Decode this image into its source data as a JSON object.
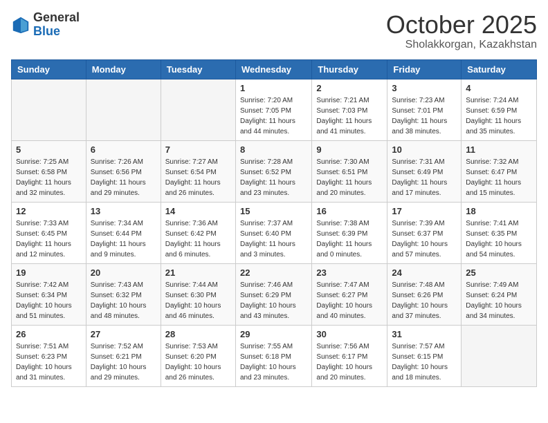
{
  "logo": {
    "general": "General",
    "blue": "Blue"
  },
  "title": "October 2025",
  "location": "Sholakkorgan, Kazakhstan",
  "weekdays": [
    "Sunday",
    "Monday",
    "Tuesday",
    "Wednesday",
    "Thursday",
    "Friday",
    "Saturday"
  ],
  "weeks": [
    [
      {
        "day": "",
        "info": ""
      },
      {
        "day": "",
        "info": ""
      },
      {
        "day": "",
        "info": ""
      },
      {
        "day": "1",
        "info": "Sunrise: 7:20 AM\nSunset: 7:05 PM\nDaylight: 11 hours\nand 44 minutes."
      },
      {
        "day": "2",
        "info": "Sunrise: 7:21 AM\nSunset: 7:03 PM\nDaylight: 11 hours\nand 41 minutes."
      },
      {
        "day": "3",
        "info": "Sunrise: 7:23 AM\nSunset: 7:01 PM\nDaylight: 11 hours\nand 38 minutes."
      },
      {
        "day": "4",
        "info": "Sunrise: 7:24 AM\nSunset: 6:59 PM\nDaylight: 11 hours\nand 35 minutes."
      }
    ],
    [
      {
        "day": "5",
        "info": "Sunrise: 7:25 AM\nSunset: 6:58 PM\nDaylight: 11 hours\nand 32 minutes."
      },
      {
        "day": "6",
        "info": "Sunrise: 7:26 AM\nSunset: 6:56 PM\nDaylight: 11 hours\nand 29 minutes."
      },
      {
        "day": "7",
        "info": "Sunrise: 7:27 AM\nSunset: 6:54 PM\nDaylight: 11 hours\nand 26 minutes."
      },
      {
        "day": "8",
        "info": "Sunrise: 7:28 AM\nSunset: 6:52 PM\nDaylight: 11 hours\nand 23 minutes."
      },
      {
        "day": "9",
        "info": "Sunrise: 7:30 AM\nSunset: 6:51 PM\nDaylight: 11 hours\nand 20 minutes."
      },
      {
        "day": "10",
        "info": "Sunrise: 7:31 AM\nSunset: 6:49 PM\nDaylight: 11 hours\nand 17 minutes."
      },
      {
        "day": "11",
        "info": "Sunrise: 7:32 AM\nSunset: 6:47 PM\nDaylight: 11 hours\nand 15 minutes."
      }
    ],
    [
      {
        "day": "12",
        "info": "Sunrise: 7:33 AM\nSunset: 6:45 PM\nDaylight: 11 hours\nand 12 minutes."
      },
      {
        "day": "13",
        "info": "Sunrise: 7:34 AM\nSunset: 6:44 PM\nDaylight: 11 hours\nand 9 minutes."
      },
      {
        "day": "14",
        "info": "Sunrise: 7:36 AM\nSunset: 6:42 PM\nDaylight: 11 hours\nand 6 minutes."
      },
      {
        "day": "15",
        "info": "Sunrise: 7:37 AM\nSunset: 6:40 PM\nDaylight: 11 hours\nand 3 minutes."
      },
      {
        "day": "16",
        "info": "Sunrise: 7:38 AM\nSunset: 6:39 PM\nDaylight: 11 hours\nand 0 minutes."
      },
      {
        "day": "17",
        "info": "Sunrise: 7:39 AM\nSunset: 6:37 PM\nDaylight: 10 hours\nand 57 minutes."
      },
      {
        "day": "18",
        "info": "Sunrise: 7:41 AM\nSunset: 6:35 PM\nDaylight: 10 hours\nand 54 minutes."
      }
    ],
    [
      {
        "day": "19",
        "info": "Sunrise: 7:42 AM\nSunset: 6:34 PM\nDaylight: 10 hours\nand 51 minutes."
      },
      {
        "day": "20",
        "info": "Sunrise: 7:43 AM\nSunset: 6:32 PM\nDaylight: 10 hours\nand 48 minutes."
      },
      {
        "day": "21",
        "info": "Sunrise: 7:44 AM\nSunset: 6:30 PM\nDaylight: 10 hours\nand 46 minutes."
      },
      {
        "day": "22",
        "info": "Sunrise: 7:46 AM\nSunset: 6:29 PM\nDaylight: 10 hours\nand 43 minutes."
      },
      {
        "day": "23",
        "info": "Sunrise: 7:47 AM\nSunset: 6:27 PM\nDaylight: 10 hours\nand 40 minutes."
      },
      {
        "day": "24",
        "info": "Sunrise: 7:48 AM\nSunset: 6:26 PM\nDaylight: 10 hours\nand 37 minutes."
      },
      {
        "day": "25",
        "info": "Sunrise: 7:49 AM\nSunset: 6:24 PM\nDaylight: 10 hours\nand 34 minutes."
      }
    ],
    [
      {
        "day": "26",
        "info": "Sunrise: 7:51 AM\nSunset: 6:23 PM\nDaylight: 10 hours\nand 31 minutes."
      },
      {
        "day": "27",
        "info": "Sunrise: 7:52 AM\nSunset: 6:21 PM\nDaylight: 10 hours\nand 29 minutes."
      },
      {
        "day": "28",
        "info": "Sunrise: 7:53 AM\nSunset: 6:20 PM\nDaylight: 10 hours\nand 26 minutes."
      },
      {
        "day": "29",
        "info": "Sunrise: 7:55 AM\nSunset: 6:18 PM\nDaylight: 10 hours\nand 23 minutes."
      },
      {
        "day": "30",
        "info": "Sunrise: 7:56 AM\nSunset: 6:17 PM\nDaylight: 10 hours\nand 20 minutes."
      },
      {
        "day": "31",
        "info": "Sunrise: 7:57 AM\nSunset: 6:15 PM\nDaylight: 10 hours\nand 18 minutes."
      },
      {
        "day": "",
        "info": ""
      }
    ]
  ]
}
